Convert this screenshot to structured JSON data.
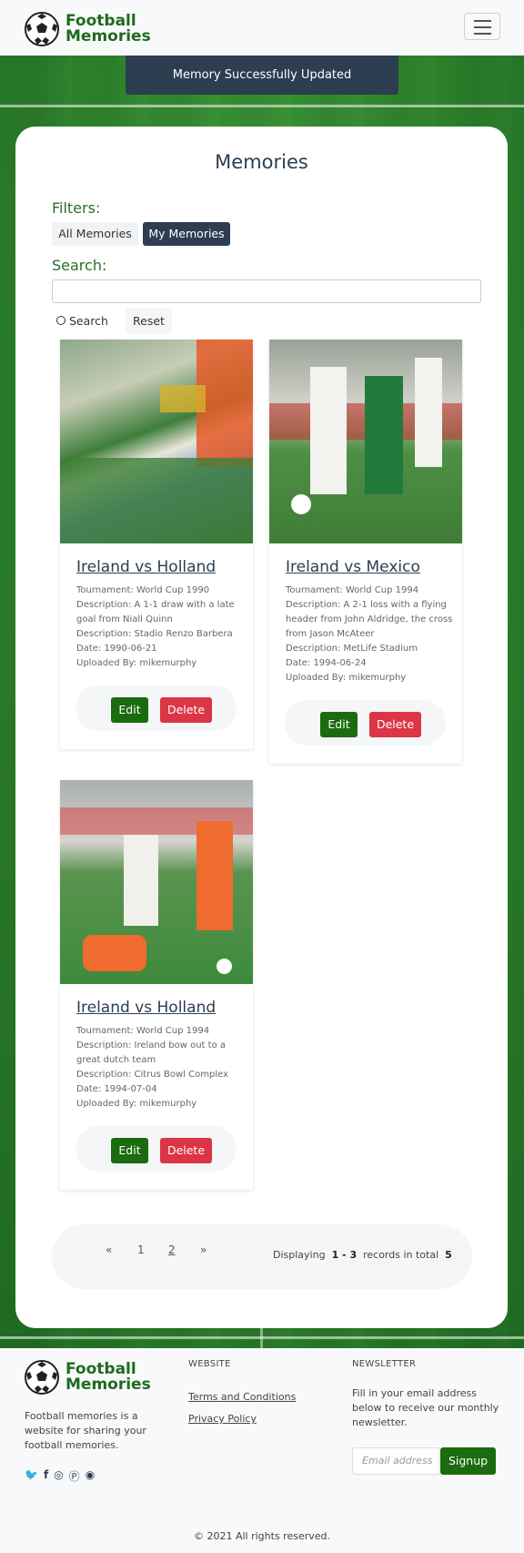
{
  "header": {
    "logo_line1": "Football",
    "logo_line2": "Memories"
  },
  "alert": "Memory Successfully Updated",
  "main": {
    "title": "Memories",
    "filters_label": "Filters:",
    "filter_all": "All Memories",
    "filter_mine": "My Memories",
    "search_label": "Search:",
    "search_value": "",
    "search_button": "Search",
    "reset_button": "Reset"
  },
  "memories": [
    {
      "title": "Ireland vs Holland",
      "tournament": "Tournament: World Cup 1990",
      "description": "Description: A 1-1 draw with a late goal from Niall Quinn",
      "venue": "Description: Stadio Renzo Barbera",
      "date": "Date: 1990-06-21",
      "uploaded": "Uploaded By: mikemurphy",
      "edit": "Edit",
      "delete": "Delete"
    },
    {
      "title": "Ireland vs Mexico",
      "tournament": "Tournament: World Cup 1994",
      "description": "Description: A 2-1 loss with a flying header from John Aldridge, the cross from Jason McAteer",
      "venue": "Description: MetLife Stadium",
      "date": "Date: 1994-06-24",
      "uploaded": "Uploaded By: mikemurphy",
      "edit": "Edit",
      "delete": "Delete"
    },
    {
      "title": "Ireland vs Holland",
      "tournament": "Tournament: World Cup 1994",
      "description": "Description: Ireland bow out to a great dutch team",
      "venue": "Description: Citrus Bowl Complex",
      "date": "Date: 1994-07-04",
      "uploaded": "Uploaded By: mikemurphy",
      "edit": "Edit",
      "delete": "Delete"
    }
  ],
  "pager": {
    "prev": "«",
    "page1": "1",
    "page2": "2",
    "next": "»",
    "displaying": "Displaying",
    "range": "1 - 3",
    "records_in_total": "records in total",
    "total": "5"
  },
  "footer": {
    "logo_line1": "Football",
    "logo_line2": "Memories",
    "about": "Football memories is a website for sharing your football memories.",
    "website_heading": "WEBSITE",
    "terms": "Terms and Conditions",
    "privacy": "Privacy Policy",
    "newsletter_heading": "NEWSLETTER",
    "newsletter_text": "Fill in your email address below to receive our monthly newsletter.",
    "email_placeholder": "Email address",
    "signup": "Signup",
    "copyright": "© 2021 All rights reserved.",
    "social_icons": [
      "twitter-icon",
      "facebook-icon",
      "instagram-icon",
      "pinterest-icon",
      "snapchat-icon"
    ]
  },
  "colors": {
    "brand_green": "#1b6b0f",
    "dark_blue": "#2c3e50",
    "danger": "#dc3545"
  }
}
